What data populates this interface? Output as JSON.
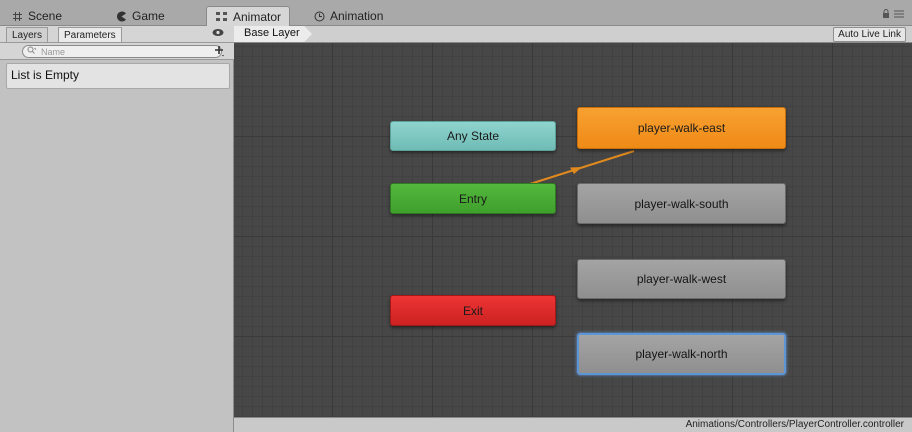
{
  "window_tabs": [
    {
      "label": "Scene",
      "icon": "grid-icon"
    },
    {
      "label": "Game",
      "icon": "pacman-icon"
    },
    {
      "label": "Animator",
      "icon": "animator-icon"
    },
    {
      "label": "Animation",
      "icon": "clock-icon"
    }
  ],
  "left_panel": {
    "tabs": [
      "Layers",
      "Parameters"
    ],
    "search_placeholder": "Name",
    "empty_text": "List is Empty"
  },
  "header": {
    "breadcrumb": "Base Layer",
    "auto_live_link": "Auto Live Link"
  },
  "graph": {
    "nodes": {
      "any_state": "Any State",
      "entry": "Entry",
      "exit": "Exit",
      "east": "player-walk-east",
      "south": "player-walk-south",
      "west": "player-walk-west",
      "north": "player-walk-north"
    },
    "colors": {
      "any_state": "#7cc8c2",
      "entry": "#48ab35",
      "exit": "#dd2a2a",
      "default_state": "#f29420",
      "state": "#999999",
      "selected_outline": "#5e95d6",
      "transition": "#e08a1e"
    }
  },
  "footer": {
    "path": "Animations/Controllers/PlayerController.controller"
  }
}
